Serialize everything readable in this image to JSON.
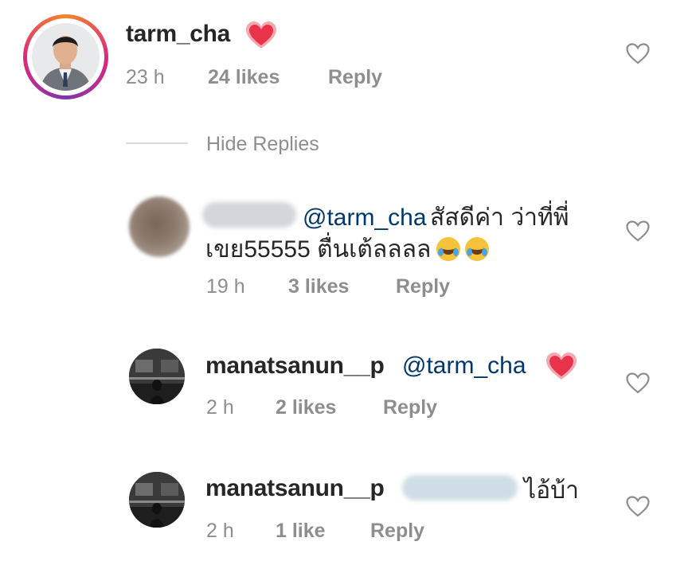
{
  "comment": {
    "username": "tarm_cha",
    "emoji": "❤️",
    "time": "23 h",
    "likes": "24 likes",
    "reply": "Reply"
  },
  "toggle_replies": "Hide Replies",
  "replies": [
    {
      "mention": "@tarm_cha",
      "text_line1": "สัสดีค่า ว่าที่พี่",
      "text_line2": "เขย55555 ตื่นเต้ลลลล",
      "time": "19 h",
      "likes": "3 likes",
      "reply": "Reply"
    },
    {
      "username": "manatsanun__p",
      "mention": "@tarm_cha",
      "time": "2 h",
      "likes": "2 likes",
      "reply": "Reply"
    },
    {
      "username": "manatsanun__p",
      "text": "ไอ้บ้า",
      "time": "2 h",
      "likes": "1 like",
      "reply": "Reply"
    }
  ],
  "colors": {
    "story_ring_start": "#f58529",
    "story_ring_end": "#dd2a7b",
    "heart_emoji": "#e8334a",
    "mention": "#00376b",
    "meta": "#8e8e8e"
  },
  "icons": [
    "heart-outline-icon",
    "heart-emoji-icon",
    "rolling-laughing-emoji-icon"
  ]
}
